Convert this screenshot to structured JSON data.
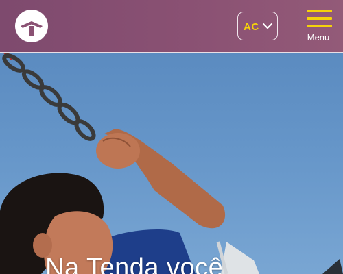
{
  "header": {
    "logo_icon": "tenda-house-roof-icon",
    "state_selector": {
      "value": "AC",
      "icon": "chevron-down-icon"
    },
    "menu": {
      "label": "Menu",
      "icon": "hamburger-menu-icon"
    }
  },
  "hero": {
    "image": "child-on-swing-photo",
    "headline": "Na Tenda você"
  },
  "colors": {
    "header_bg": "#8a5173",
    "accent_yellow": "#f5d20a",
    "sky_blue": "#6696c9"
  }
}
